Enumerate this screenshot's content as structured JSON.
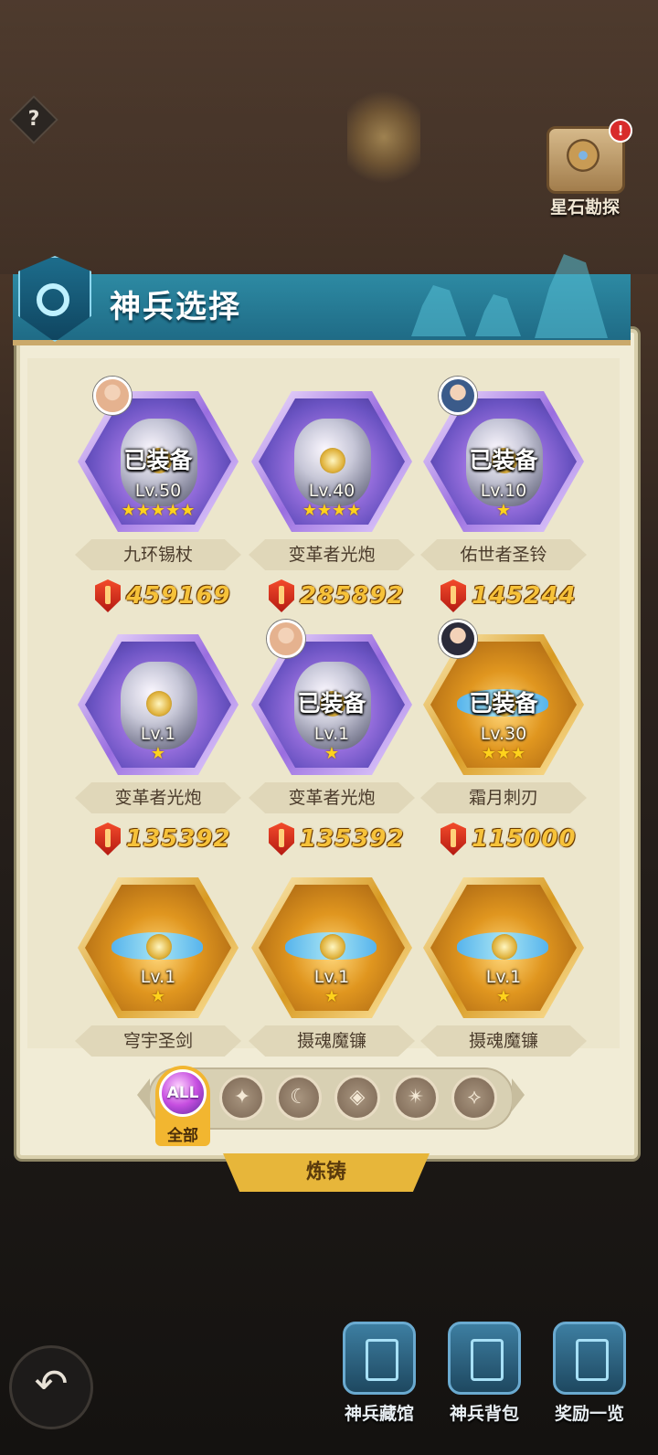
{
  "header": {
    "title": "神兵选择"
  },
  "explore": {
    "label": "星石勘探",
    "badge": "!"
  },
  "help": {
    "label": "?"
  },
  "items": [
    {
      "name": "九环锡杖",
      "level": "Lv.50",
      "stars": "★★★★★",
      "equipped": "已装备",
      "power": "459169",
      "rarity": "purple",
      "has_avatar": true
    },
    {
      "name": "变革者光炮",
      "level": "Lv.40",
      "stars": "★★★★",
      "equipped": "",
      "power": "285892",
      "rarity": "purple",
      "has_avatar": false
    },
    {
      "name": "佑世者圣铃",
      "level": "Lv.10",
      "stars": "★",
      "equipped": "已装备",
      "power": "145244",
      "rarity": "purple",
      "has_avatar": true
    },
    {
      "name": "变革者光炮",
      "level": "Lv.1",
      "stars": "★",
      "equipped": "",
      "power": "135392",
      "rarity": "purple",
      "has_avatar": false
    },
    {
      "name": "变革者光炮",
      "level": "Lv.1",
      "stars": "★",
      "equipped": "已装备",
      "power": "135392",
      "rarity": "purple",
      "has_avatar": true
    },
    {
      "name": "霜月刺刃",
      "level": "Lv.30",
      "stars": "★★★",
      "equipped": "已装备",
      "power": "115000",
      "rarity": "gold",
      "has_avatar": true
    },
    {
      "name": "穹宇圣剑",
      "level": "Lv.1",
      "stars": "★",
      "equipped": "",
      "power": "",
      "rarity": "gold",
      "has_avatar": false
    },
    {
      "name": "摄魂魔镰",
      "level": "Lv.1",
      "stars": "★",
      "equipped": "",
      "power": "",
      "rarity": "gold",
      "has_avatar": false
    },
    {
      "name": "摄魂魔镰",
      "level": "Lv.1",
      "stars": "★",
      "equipped": "",
      "power": "",
      "rarity": "gold",
      "has_avatar": false
    }
  ],
  "filters": {
    "all_button": "ALL",
    "all_label": "全部",
    "icons": [
      "wings-class-icon",
      "crescent-class-icon",
      "shield-class-icon",
      "shuriken-class-icon",
      "staff-class-icon"
    ]
  },
  "forge": {
    "label": "炼铸"
  },
  "bottom_nav": [
    {
      "label": "神兵藏馆",
      "icon": "armory-icon"
    },
    {
      "label": "神兵背包",
      "icon": "backpack-icon"
    },
    {
      "label": "奖励一览",
      "icon": "treasure-chest-icon"
    }
  ],
  "colors": {
    "header": "#1f6b86",
    "panel": "#f1ecd6",
    "power_text": "#f6c23a",
    "star": "#ffd21c"
  }
}
